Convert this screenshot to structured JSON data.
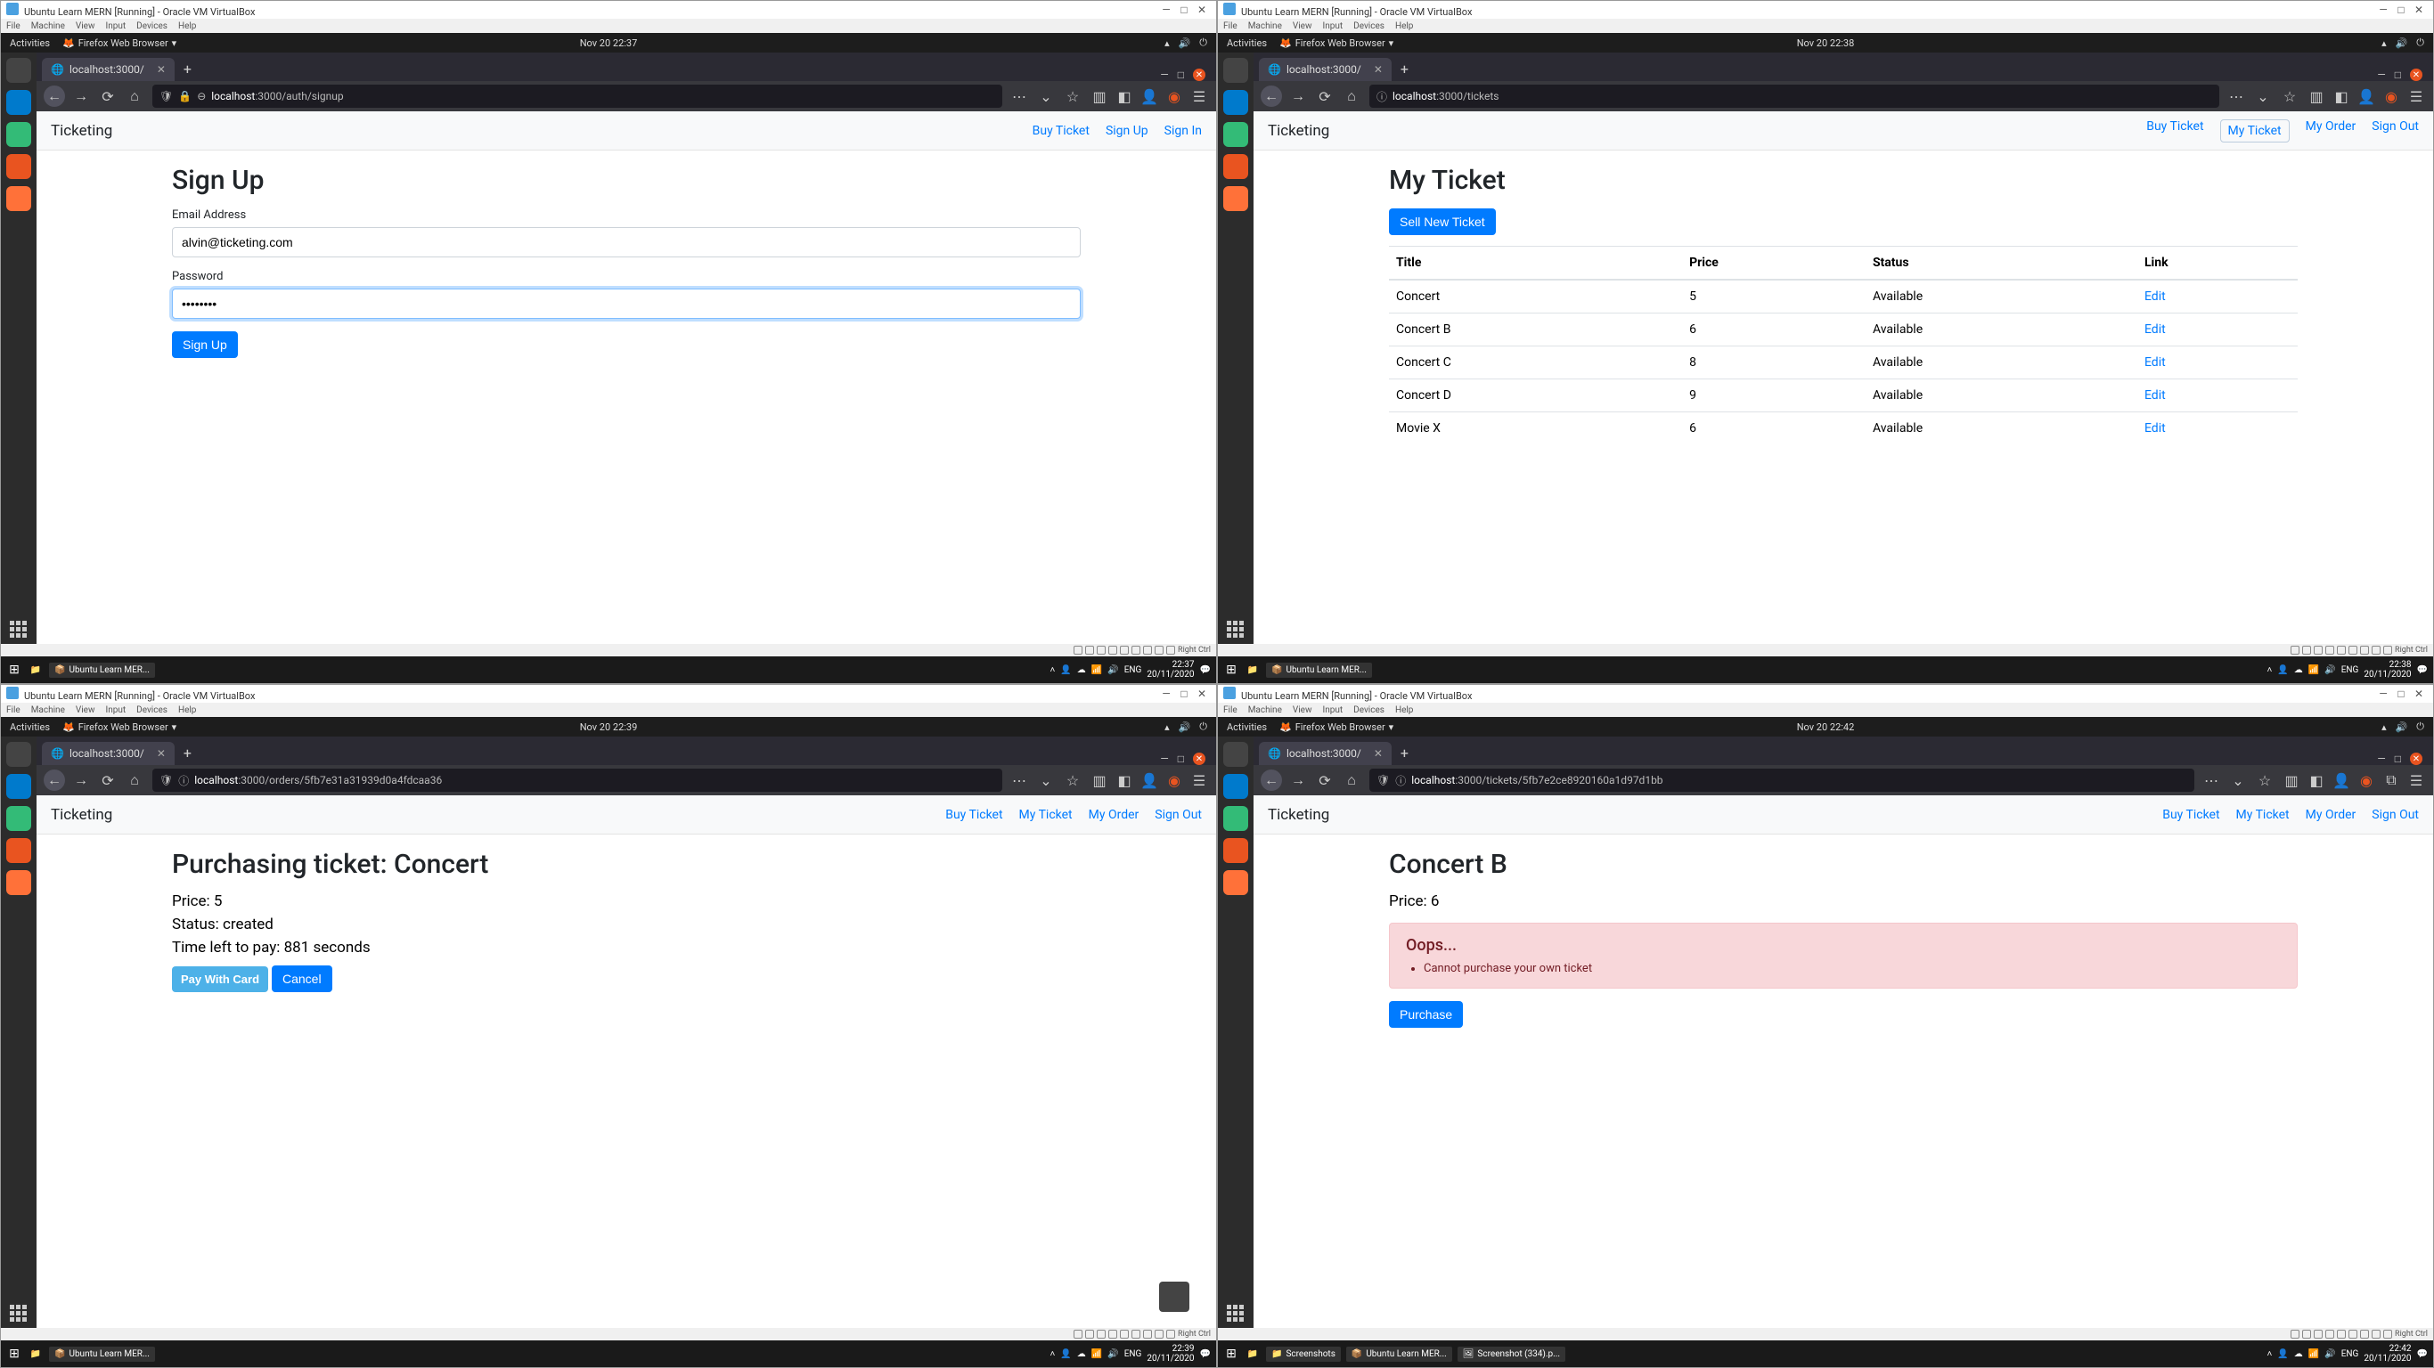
{
  "vb": {
    "title": "Ubuntu Learn MERN [Running] - Oracle VM VirtualBox",
    "menu": [
      "File",
      "Machine",
      "View",
      "Input",
      "Devices",
      "Help"
    ],
    "rightctrl": "Right Ctrl"
  },
  "wintask": {
    "app": "Ubuntu Learn MER...",
    "screenshots_app": "Screenshots",
    "screenshot_file": "Screenshot (334).p..."
  },
  "ubuntu": {
    "activities": "Activities",
    "browser": "Firefox Web Browser"
  },
  "panes": {
    "tl": {
      "time": "Nov 20  22:37",
      "wintime": "22:37",
      "windate": "20/11/2020",
      "tab": "localhost:3000/",
      "url_host": "localhost",
      "url_path": ":3000/auth/signup",
      "nav": {
        "brand": "Ticketing",
        "links": [
          "Buy Ticket",
          "Sign Up",
          "Sign In"
        ]
      },
      "page": {
        "title": "Sign Up",
        "email_label": "Email Address",
        "email_value": "alvin@ticketing.com",
        "password_label": "Password",
        "password_value": "••••••••",
        "submit": "Sign Up"
      }
    },
    "tr": {
      "time": "Nov 20  22:38",
      "wintime": "22:38",
      "windate": "20/11/2020",
      "tab": "localhost:3000/",
      "url_host": "localhost",
      "url_path": ":3000/tickets",
      "nav": {
        "brand": "Ticketing",
        "links": [
          "Buy Ticket",
          "My Ticket",
          "My Order",
          "Sign Out"
        ],
        "active": 1
      },
      "page": {
        "title": "My Ticket",
        "sell_btn": "Sell New Ticket",
        "columns": [
          "Title",
          "Price",
          "Status",
          "Link"
        ],
        "rows": [
          {
            "title": "Concert",
            "price": "5",
            "status": "Available",
            "link": "Edit"
          },
          {
            "title": "Concert B",
            "price": "6",
            "status": "Available",
            "link": "Edit"
          },
          {
            "title": "Concert C",
            "price": "8",
            "status": "Available",
            "link": "Edit"
          },
          {
            "title": "Concert D",
            "price": "9",
            "status": "Available",
            "link": "Edit"
          },
          {
            "title": "Movie X",
            "price": "6",
            "status": "Available",
            "link": "Edit"
          }
        ]
      }
    },
    "bl": {
      "time": "Nov 20  22:39",
      "wintime": "22:39",
      "windate": "20/11/2020",
      "tab": "localhost:3000/",
      "url_host": "localhost",
      "url_path": ":3000/orders/5fb7e31a31939d0a4fdcaa36",
      "nav": {
        "brand": "Ticketing",
        "links": [
          "Buy Ticket",
          "My Ticket",
          "My Order",
          "Sign Out"
        ]
      },
      "page": {
        "title": "Purchasing ticket: Concert",
        "price_label": "Price: 5",
        "status_label": "Status: created",
        "timer_label": "Time left to pay: 881 seconds",
        "pay_btn": "Pay With Card",
        "cancel_btn": "Cancel"
      }
    },
    "br": {
      "time": "Nov 20  22:42",
      "wintime": "22:42",
      "windate": "20/11/2020",
      "tab": "localhost:3000/",
      "url_host": "localhost",
      "url_path": ":3000/tickets/5fb7e2ce8920160a1d97d1bb",
      "nav": {
        "brand": "Ticketing",
        "links": [
          "Buy Ticket",
          "My Ticket",
          "My Order",
          "Sign Out"
        ]
      },
      "page": {
        "title": "Concert B",
        "price_label": "Price: 6",
        "error_title": "Oops...",
        "error_item": "Cannot purchase your own ticket",
        "purchase_btn": "Purchase"
      }
    }
  }
}
